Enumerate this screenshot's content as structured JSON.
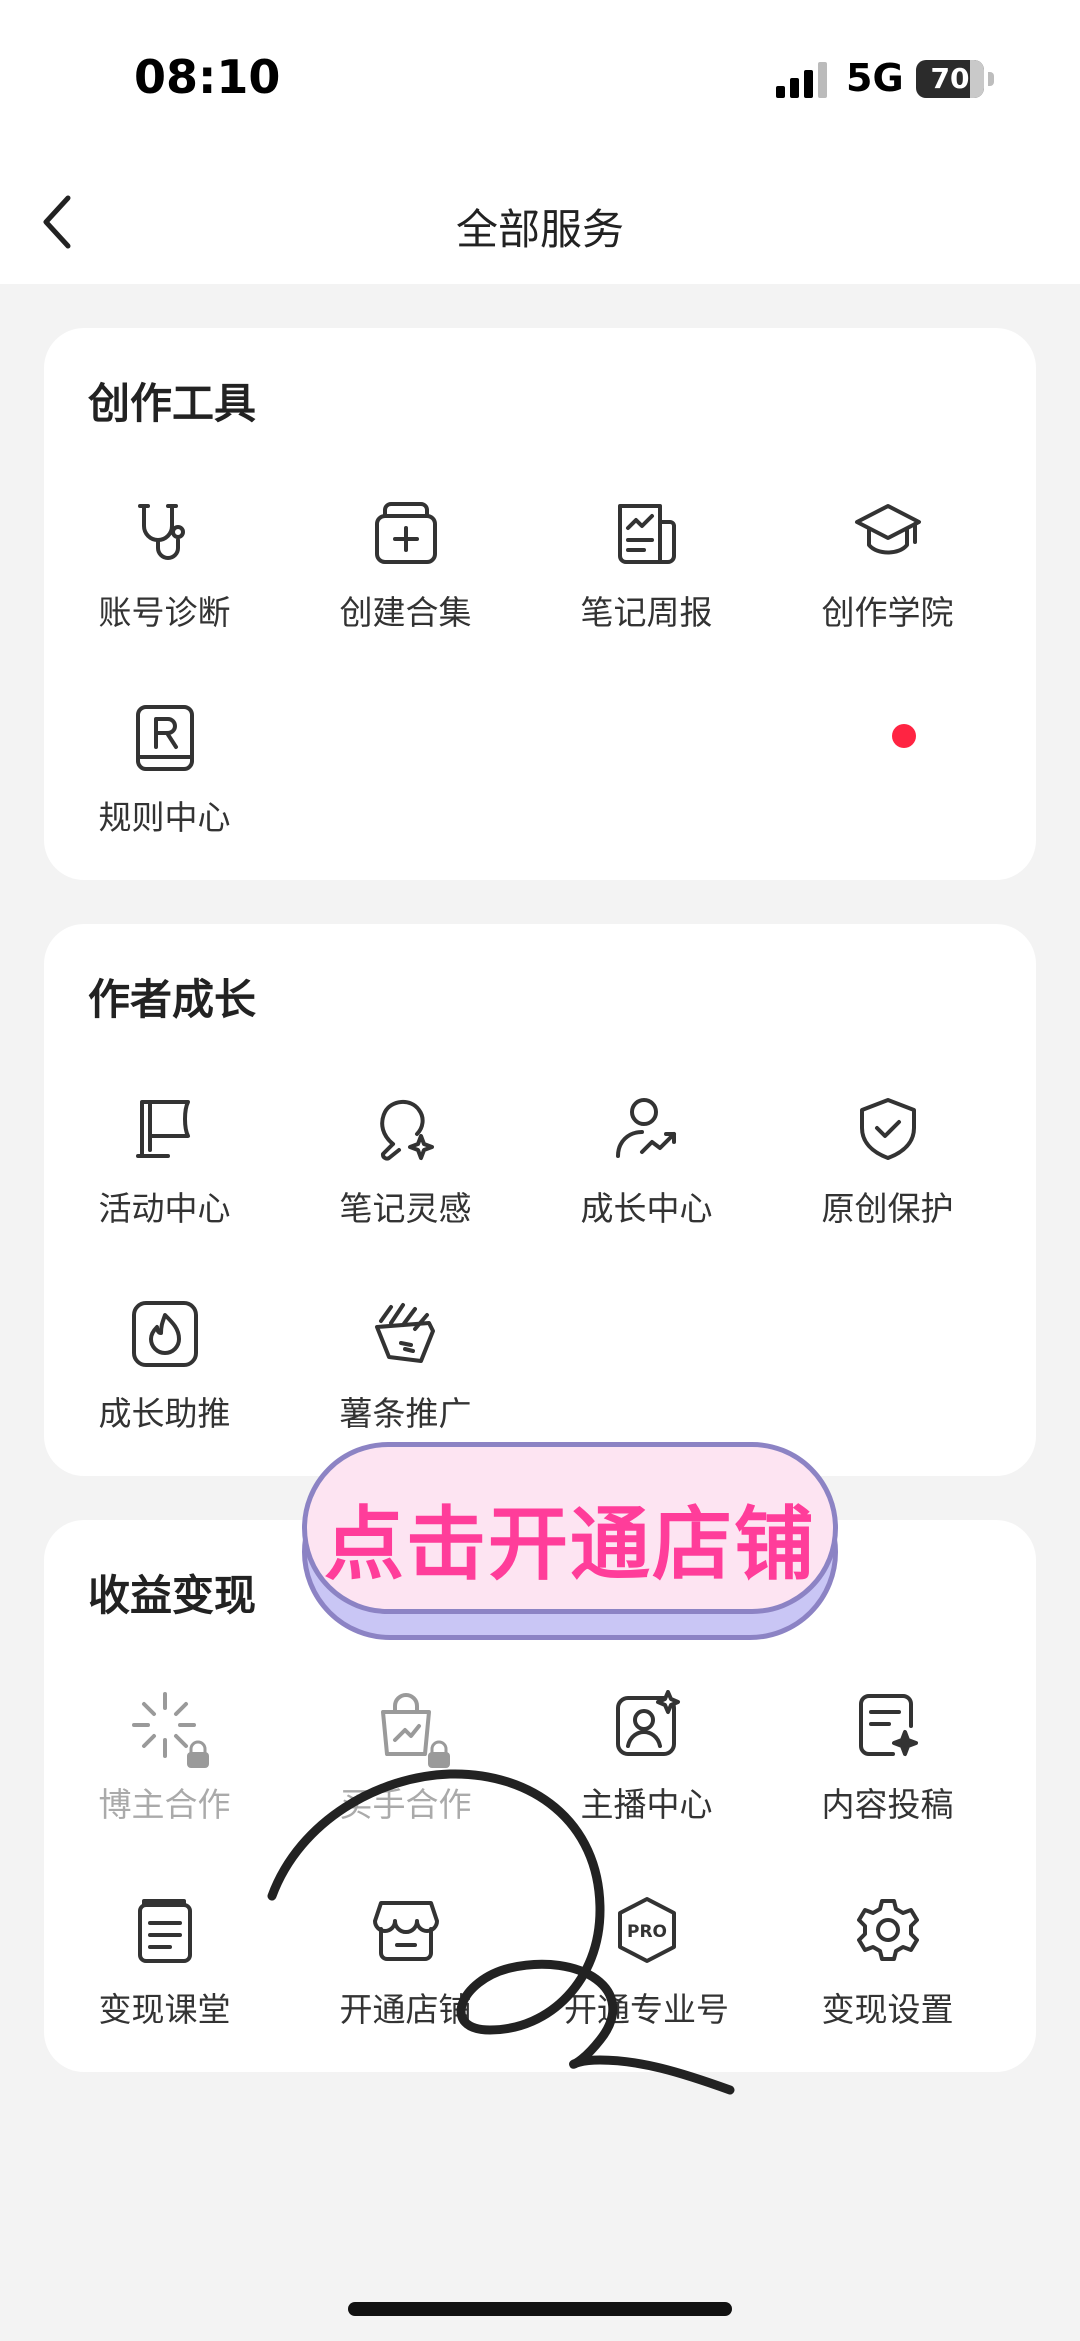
{
  "status_bar": {
    "time": "08:10",
    "network": "5G",
    "battery": "70"
  },
  "nav": {
    "title": "全部服务"
  },
  "sections": [
    {
      "title": "创作工具",
      "items": [
        {
          "label": "账号诊断",
          "icon": "stethoscope-icon"
        },
        {
          "label": "创建合集",
          "icon": "add-collection-icon"
        },
        {
          "label": "笔记周报",
          "icon": "weekly-report-icon"
        },
        {
          "label": "创作学院",
          "icon": "graduation-cap-icon"
        },
        {
          "label": "规则中心",
          "icon": "rules-book-icon"
        }
      ]
    },
    {
      "title": "作者成长",
      "items": [
        {
          "label": "活动中心",
          "icon": "flag-icon"
        },
        {
          "label": "笔记灵感",
          "icon": "lightbulb-icon"
        },
        {
          "label": "成长中心",
          "icon": "user-growth-icon"
        },
        {
          "label": "原创保护",
          "icon": "shield-check-icon",
          "badge": true
        },
        {
          "label": "成长助推",
          "icon": "flame-icon"
        },
        {
          "label": "薯条推广",
          "icon": "fries-icon"
        }
      ]
    },
    {
      "title": "收益变现",
      "items": [
        {
          "label": "博主合作",
          "icon": "sparkle-burst-icon",
          "locked": true
        },
        {
          "label": "买手合作",
          "icon": "shopping-bag-icon",
          "locked": true
        },
        {
          "label": "主播中心",
          "icon": "streamer-icon"
        },
        {
          "label": "内容投稿",
          "icon": "submission-icon"
        },
        {
          "label": "变现课堂",
          "icon": "course-book-icon"
        },
        {
          "label": "开通店铺",
          "icon": "storefront-icon"
        },
        {
          "label": "开通专业号",
          "icon": "pro-badge-icon"
        },
        {
          "label": "变现设置",
          "icon": "gear-icon"
        }
      ]
    }
  ],
  "promo": {
    "text": "点击开通店铺"
  },
  "colors": {
    "accent": "#ff2442",
    "promo_text": "#ff3d9a",
    "promo_fill": "#fde4f2",
    "promo_border": "#8c83c4"
  }
}
